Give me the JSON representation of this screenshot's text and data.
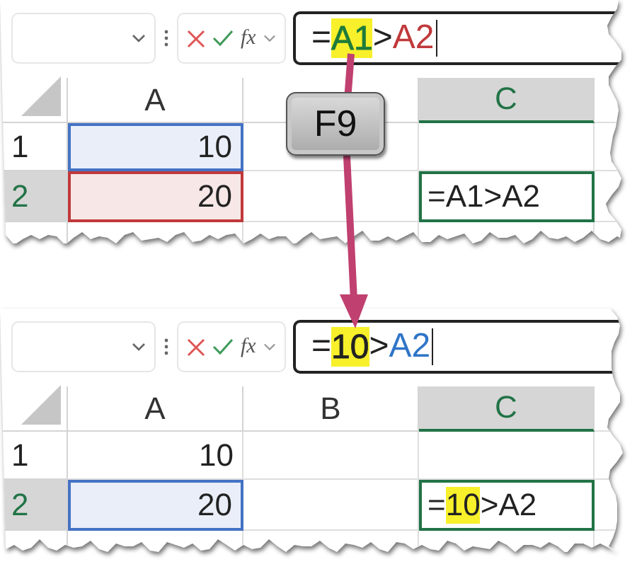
{
  "panels": [
    {
      "formula_bar": {
        "function_label": "fx",
        "tokens": [
          {
            "text": "=",
            "color": "#222222",
            "highlighted": false
          },
          {
            "text": "A1",
            "color": "#1e7b3a",
            "highlighted": true
          },
          {
            "text": ">",
            "color": "#222222",
            "highlighted": false
          },
          {
            "text": "A2",
            "color": "#c0393b",
            "highlighted": false
          }
        ]
      },
      "columns": [
        {
          "label": "A",
          "selected": false
        },
        {
          "selected": false
        },
        {
          "label": "C",
          "selected": true
        }
      ],
      "rows": [
        {
          "number": "1",
          "selected": false,
          "cells": [
            {
              "text": "10",
              "color": "#4472c4"
            },
            {},
            {}
          ]
        },
        {
          "number": "2",
          "selected": true,
          "cells": [
            {
              "text": "20",
              "color": "#c0393b"
            },
            {},
            {
              "parts": [
                {
                  "text": "=A1>A2",
                  "highlighted": false
                }
              ],
              "active": true
            }
          ]
        }
      ]
    },
    {
      "formula_bar": {
        "function_label": "fx",
        "tokens": [
          {
            "text": "=",
            "color": "#222222",
            "highlighted": false
          },
          {
            "text": "10",
            "color": "#222222",
            "highlighted": true
          },
          {
            "text": ">",
            "color": "#222222",
            "highlighted": false
          },
          {
            "text": "A2",
            "color": "#2f75c8",
            "highlighted": false
          }
        ]
      },
      "columns": [
        {
          "label": "A",
          "selected": false
        },
        {
          "label": "B",
          "selected": false
        },
        {
          "label": "C",
          "selected": true
        }
      ],
      "rows": [
        {
          "number": "1",
          "selected": false,
          "cells": [
            {
              "text": "10"
            },
            {},
            {}
          ]
        },
        {
          "number": "2",
          "selected": true,
          "cells": [
            {
              "text": "20",
              "color": "#4472c4"
            },
            {},
            {
              "parts": [
                {
                  "text": "=",
                  "highlighted": false
                },
                {
                  "text": "10",
                  "highlighted": true
                },
                {
                  "text": ">A2",
                  "highlighted": false
                }
              ],
              "active": true
            }
          ]
        }
      ]
    }
  ],
  "key": {
    "label": "F9"
  }
}
